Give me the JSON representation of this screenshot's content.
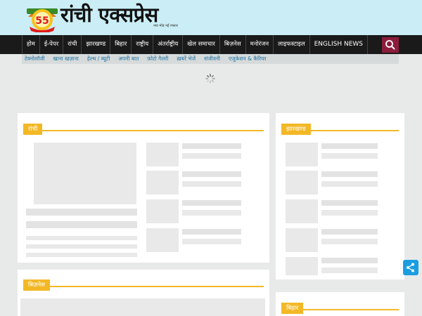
{
  "site": {
    "title": "रांची एक्सप्रेस",
    "tagline": "नया मोड़ नई रफ्तार",
    "badge_number": "55",
    "badge_text": "प्रकाशन का",
    "badge_sub": "वां वर्ष"
  },
  "nav": {
    "items": [
      "होम",
      "ई-पेपर",
      "रांची",
      "झारखण्ड",
      "बिहार",
      "राष्ट्रीय",
      "अंतर्राष्ट्रीय",
      "खेल समाचार",
      "बिज़नेस",
      "मनोरंजन",
      "लाइफस्टाइल",
      "ENGLISH NEWS"
    ]
  },
  "subnav": {
    "items": [
      "टेक्नोलॉजी",
      "खाना खज़ाना",
      "हेल्थ / ब्यूटी",
      "अपनी बात",
      "फ़ोटो गैलरी",
      "ख़बरें भेजें",
      "संजीवनी",
      "एजुकेशन & कैरियर"
    ]
  },
  "sections": {
    "ranchi": "रांची",
    "jharkhand": "झारखण्ड",
    "business": "बिज़नेस",
    "bihar": "बिहार"
  },
  "colors": {
    "header_bg": "#cbeef6",
    "nav_bg": "#1a1a1a",
    "accent": "#f3b826",
    "search_bg": "#8c1c3c",
    "share_bg": "#1b9ee0",
    "subnav_link": "#1a6fa3"
  },
  "icons": {
    "search": "search-icon",
    "share": "share-icon",
    "loader": "loading-spinner-icon"
  }
}
